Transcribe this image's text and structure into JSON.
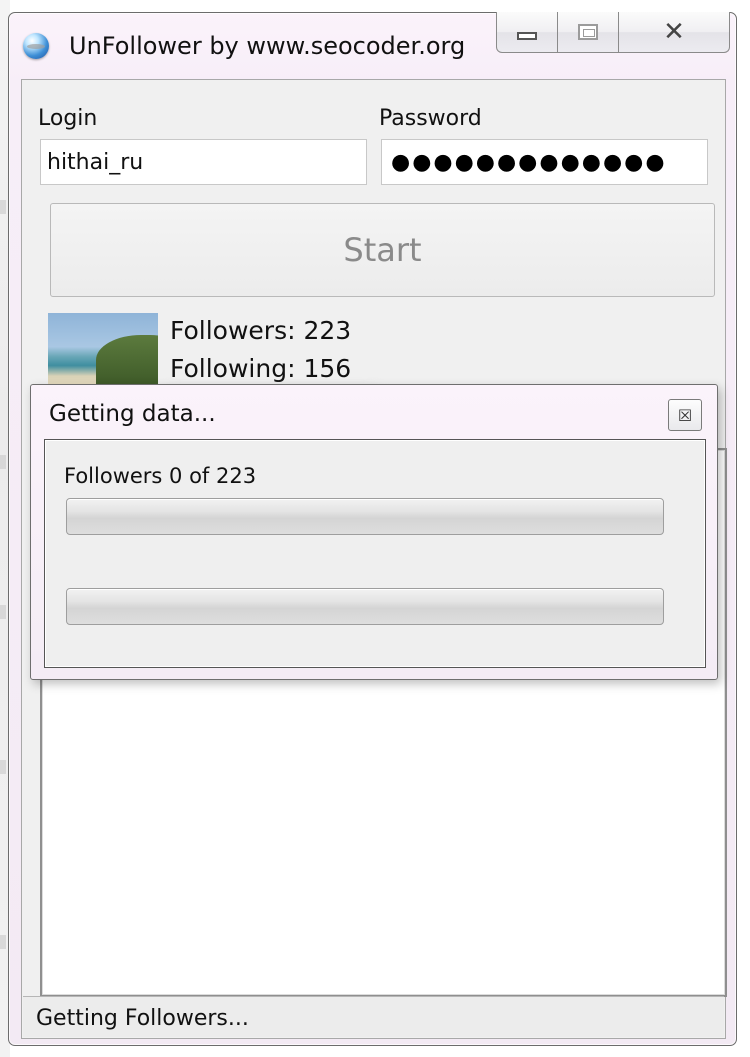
{
  "window": {
    "title": "UnFollower by www.seocoder.org",
    "controls": {
      "minimize": "minimize-icon",
      "maximize": "maximize-icon",
      "close": "close-icon"
    }
  },
  "form": {
    "login_label": "Login",
    "login_value": "hithai_ru",
    "password_label": "Password",
    "password_masked": "●●●●●●●●●●●●●",
    "start_label": "Start"
  },
  "profile": {
    "followers_text": "Followers: 223",
    "following_text": "Following: 156"
  },
  "status_bar": {
    "text": "Getting Followers..."
  },
  "dialog": {
    "title": "Getting data...",
    "close_icon": "close-icon",
    "progress_label": "Followers 0 of 223",
    "progress": [
      0,
      0
    ]
  }
}
